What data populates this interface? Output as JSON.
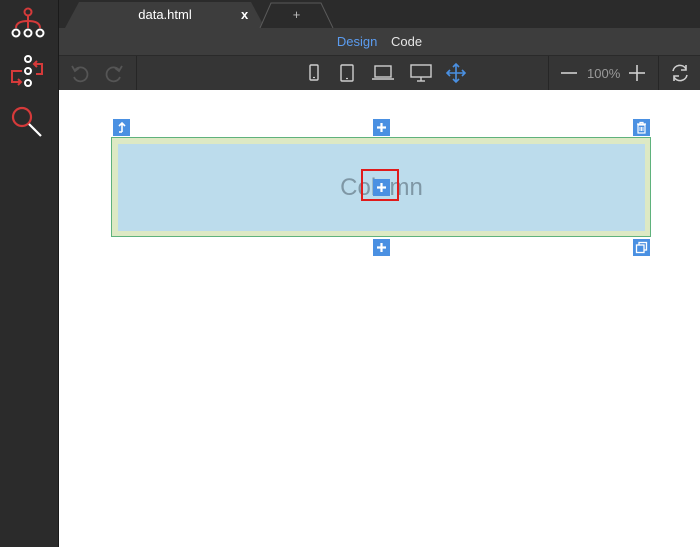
{
  "tabs": [
    {
      "label": "data.html",
      "close": "x"
    },
    {
      "label": "+"
    }
  ],
  "modes": {
    "design": "Design",
    "code": "Code"
  },
  "toolbar": {
    "zoom": "100%"
  },
  "canvas": {
    "column_label": "Column"
  },
  "sidebar": {
    "icons": [
      "hierarchy-icon",
      "refactor-icon",
      "search-icon"
    ]
  },
  "colors": {
    "accent": "#4a90e2",
    "highlight": "#e01b1b",
    "sidebar_icon": "#e03a3a"
  }
}
